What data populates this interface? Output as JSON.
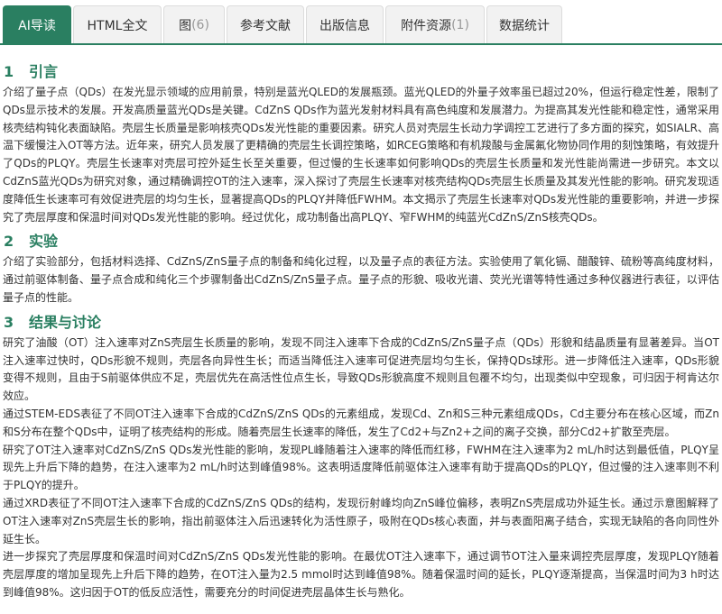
{
  "tabs": [
    {
      "label": "AI导读",
      "count": null,
      "active": true
    },
    {
      "label": "HTML全文",
      "count": null,
      "active": false
    },
    {
      "label": "图",
      "count": "6",
      "active": false
    },
    {
      "label": "参考文献",
      "count": null,
      "active": false
    },
    {
      "label": "出版信息",
      "count": null,
      "active": false
    },
    {
      "label": "附件资源",
      "count": "1",
      "active": false
    },
    {
      "label": "数据统计",
      "count": null,
      "active": false
    }
  ],
  "colors": {
    "accent": "#2a7f61",
    "tab_bg": "#f2f2f2",
    "text": "#333333"
  },
  "sections": [
    {
      "number": "1",
      "title": "引言",
      "paragraphs": [
        "介绍了量子点（QDs）在发光显示领域的应用前景，特别是蓝光QLED的发展瓶颈。蓝光QLED的外量子效率虽已超过20%，但运行稳定性差，限制了QDs显示技术的发展。开发高质量蓝光QDs是关键。CdZnS QDs作为蓝光发射材料具有高色纯度和发展潜力。为提高其发光性能和稳定性，通常采用核壳结构钝化表面缺陷。壳层生长质量是影响核壳QDs发光性能的重要因素。研究人员对壳层生长动力学调控工艺进行了多方面的探究，如SIALR、高温下缓慢注入OT等方法。近年来，研究人员发展了更精确的壳层生长调控策略，如RCEG策略和有机羧酸与金属氟化物协同作用的刻蚀策略，有效提升了QDs的PLQY。壳层生长速率对壳层可控外延生长至关重要，但过慢的生长速率如何影响QDs的壳层生长质量和发光性能尚需进一步研究。本文以CdZnS蓝光QDs为研究对象，通过精确调控OT的注入速率，深入探讨了壳层生长速率对核壳结构QDs壳层生长质量及其发光性能的影响。研究发现适度降低生长速率可有效促进壳层的均匀生长，显著提高QDs的PLQY并降低FWHM。本文揭示了壳层生长速率对QDs发光性能的重要影响，并进一步探究了壳层厚度和保温时间对QDs发光性能的影响。经过优化，成功制备出高PLQY、窄FWHM的纯蓝光CdZnS/ZnS核壳QDs。"
      ]
    },
    {
      "number": "2",
      "title": "实验",
      "paragraphs": [
        "介绍了实验部分，包括材料选择、CdZnS/ZnS量子点的制备和纯化过程，以及量子点的表征方法。实验使用了氧化镉、醋酸锌、硫粉等高纯度材料，通过前驱体制备、量子点合成和纯化三个步骤制备出CdZnS/ZnS量子点。量子点的形貌、吸收光谱、荧光光谱等特性通过多种仪器进行表征，以评估量子点的性能。"
      ]
    },
    {
      "number": "3",
      "title": "结果与讨论",
      "paragraphs": [
        "研究了油酸（OT）注入速率对ZnS壳层生长质量的影响，发现不同注入速率下合成的CdZnS/ZnS量子点（QDs）形貌和结晶质量有显著差异。当OT注入速率过快时，QDs形貌不规则，壳层各向异性生长；而适当降低注入速率可促进壳层均匀生长，保持QDs球形。进一步降低注入速率，QDs形貌变得不规则，且由于S前驱体供应不足，壳层优先在高活性位点生长，导致QDs形貌高度不规则且包覆不均匀，出现类似中空现象，可归因于柯肯达尔效应。",
        "通过STEM-EDS表征了不同OT注入速率下合成的CdZnS/ZnS QDs的元素组成，发现Cd、Zn和S三种元素组成QDs，Cd主要分布在核心区域，而Zn和S分布在整个QDs中，证明了核壳结构的形成。随着壳层生长速率的降低，发生了Cd2+与Zn2+之间的离子交换，部分Cd2+扩散至壳层。",
        "研究了OT注入速率对CdZnS/ZnS QDs发光性能的影响，发现PL峰随着注入速率的降低而红移，FWHM在注入速率为2 mL/h时达到最低值，PLQY呈现先上升后下降的趋势，在注入速率为2 mL/h时达到峰值98%。这表明适度降低前驱体注入速率有助于提高QDs的PLQY，但过慢的注入速率则不利于PLQY的提升。",
        "通过XRD表征了不同OT注入速率下合成的CdZnS/ZnS QDs的结构，发现衍射峰均向ZnS峰位偏移，表明ZnS壳层成功外延生长。通过示意图解释了OT注入速率对ZnS壳层生长的影响，指出前驱体注入后迅速转化为活性原子，吸附在QDs核心表面，并与表面阳离子结合，实现无缺陷的各向同性外延生长。",
        "进一步探究了壳层厚度和保温时间对CdZnS/ZnS QDs发光性能的影响。在最优OT注入速率下，通过调节OT注入量来调控壳层厚度，发现PLQY随着壳层厚度的增加呈现先上升后下降的趋势，在OT注入量为2.5 mmol时达到峰值98%。随着保温时间的延长，PLQY逐渐提高，当保温时间为3 h时达到峰值98%。这归因于OT的低反应活性，需要充分的时间促进壳层晶体生长与熟化。"
      ]
    }
  ]
}
